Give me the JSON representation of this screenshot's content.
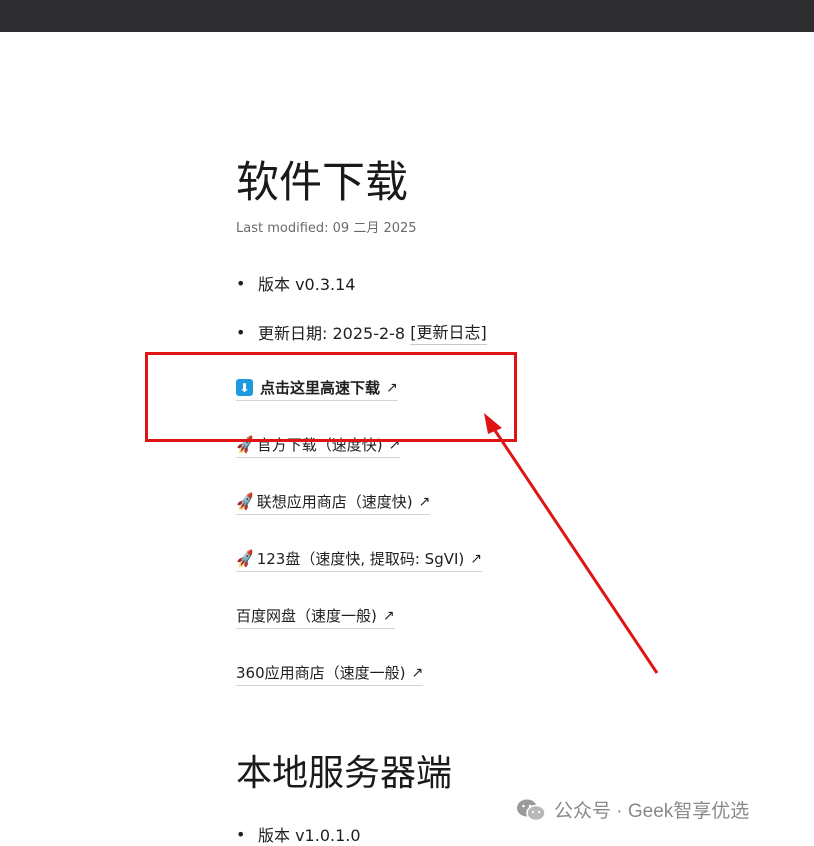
{
  "page": {
    "title": "软件下载",
    "last_modified": "Last modified: 09 二月 2025",
    "version_item": "版本 v0.3.14",
    "update_date_prefix": "更新日期: 2025-2-8 ",
    "changelog_link": "[更新日志]",
    "section2_title": "本地服务器端",
    "section2_version_item": "版本 v1.0.1.0"
  },
  "downloads": [
    {
      "label": "点击这里高速下载",
      "icon": "download-arrow-icon",
      "bold": true
    },
    {
      "label": "官方下载（速度快)",
      "icon": "rocket-icon",
      "bold": false
    },
    {
      "label": "联想应用商店（速度快)",
      "icon": "rocket-icon",
      "bold": false
    },
    {
      "label": "123盘（速度快, 提取码: SgVI)",
      "icon": "rocket-icon",
      "bold": false
    },
    {
      "label": "百度网盘（速度一般)",
      "icon": "",
      "bold": false
    },
    {
      "label": "360应用商店（速度一般)",
      "icon": "",
      "bold": false
    }
  ],
  "external_arrow": "↗",
  "bullet": "•",
  "watermark": {
    "text": "公众号 · Geek智享优选",
    "icon": "wechat-icon"
  },
  "colors": {
    "topbar": "#2e2e30",
    "annotation_red": "#e01414",
    "download_icon_blue": "#1e9be0",
    "rocket": "#c0395a"
  }
}
